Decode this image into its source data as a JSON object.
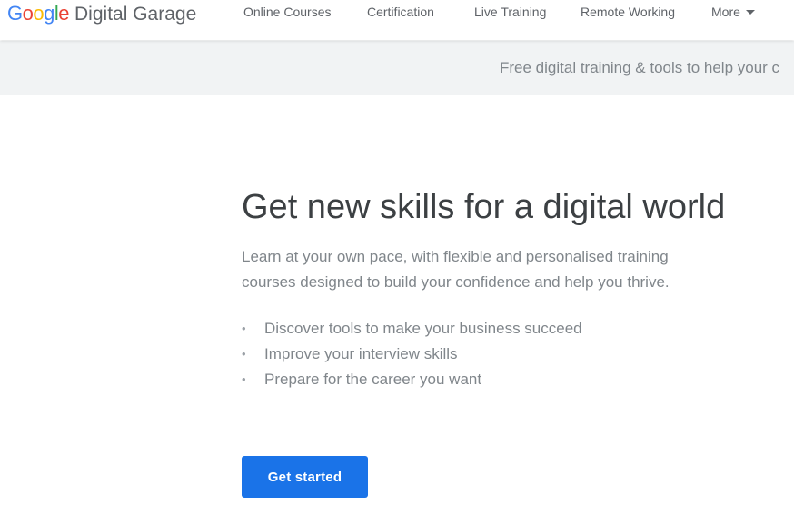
{
  "header": {
    "logo": {
      "google_letters": [
        "G",
        "o",
        "o",
        "g",
        "l",
        "e"
      ],
      "product": "Digital Garage"
    },
    "nav": [
      {
        "label": "Online Courses"
      },
      {
        "label": "Certification"
      },
      {
        "label": "Live Training"
      },
      {
        "label": "Remote Working"
      },
      {
        "label": "More"
      }
    ],
    "more_icon": "caret-down-icon"
  },
  "banner": {
    "text": "Free digital training & tools to help your c"
  },
  "hero": {
    "title": "Get new skills for a digital world",
    "subtitle": "Learn at your own pace, with flexible and personalised training courses designed to build your confidence and help you thrive.",
    "bullets": [
      "Discover tools to make your business succeed",
      "Improve your interview skills",
      "Prepare for the career you want"
    ],
    "bullet_marker": "•",
    "cta_label": "Get started"
  },
  "colors": {
    "google_blue": "#4285f4",
    "google_red": "#ea4335",
    "google_yellow": "#fbbc05",
    "google_green": "#34a853",
    "cta_blue": "#1a73e8",
    "banner_bg": "#f1f3f4",
    "title_text": "#3c4043",
    "muted_text": "#80868b"
  }
}
